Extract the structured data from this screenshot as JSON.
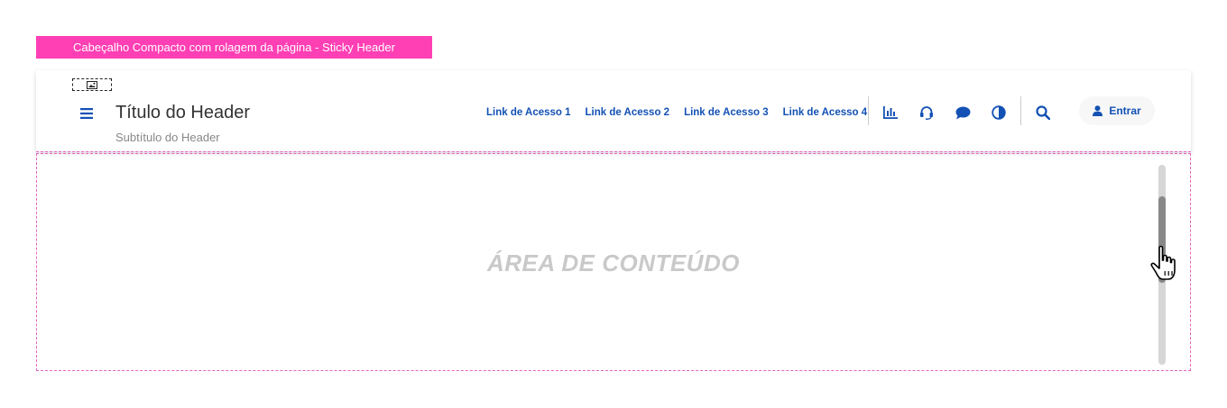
{
  "annotation": {
    "label": "Cabeçalho Compacto com rolagem da página - Sticky Header"
  },
  "header": {
    "title": "Título do Header",
    "subtitle": "Subtítulo do Header",
    "links": [
      "Link de Acesso 1",
      "Link de Acesso 2",
      "Link de Acesso 3",
      "Link de Acesso 4"
    ],
    "icons": [
      "chart-icon",
      "headset-icon",
      "chat-icon",
      "contrast-icon",
      "search-icon"
    ],
    "login_label": "Entrar"
  },
  "content": {
    "label": "ÁREA DE CONTEÚDO",
    "scroll_position": 0.28
  },
  "colors": {
    "accent": "#1351b4",
    "annotation": "#ff3fb4",
    "dashed_border": "#e463c0"
  }
}
